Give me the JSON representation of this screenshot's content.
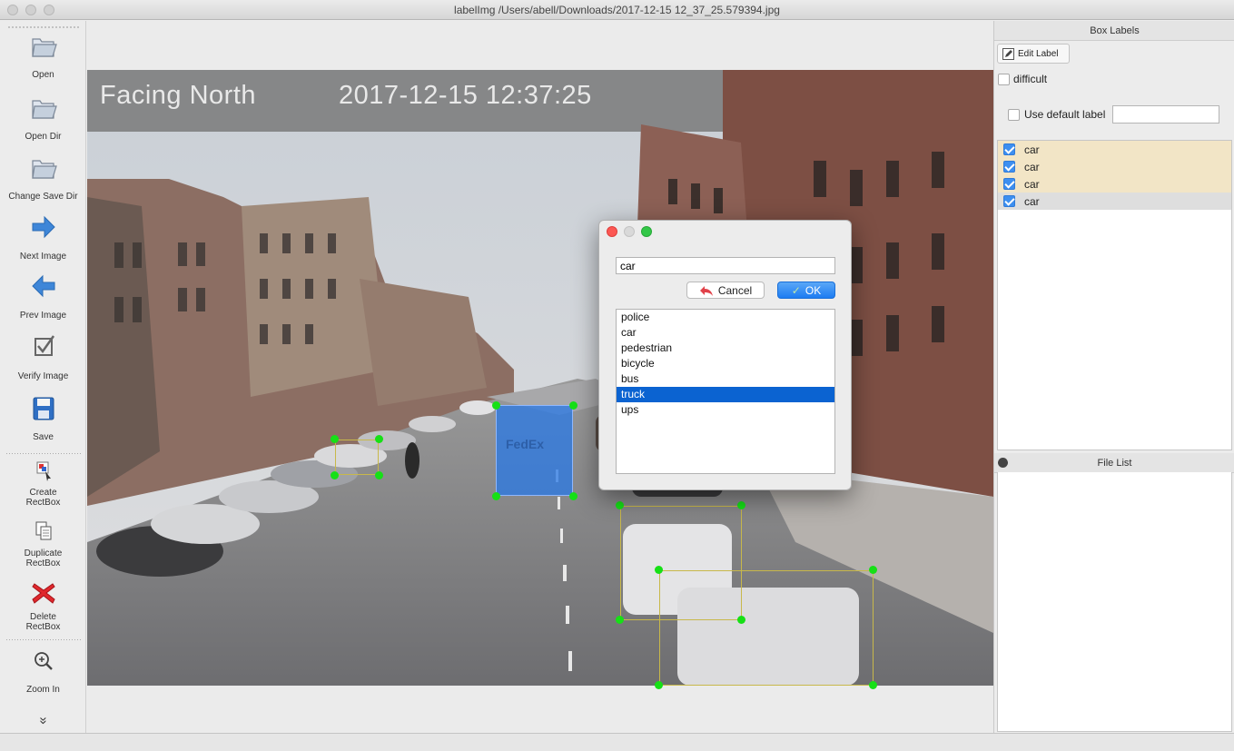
{
  "window": {
    "title": "labelImg /Users/abell/Downloads/2017-12-15 12_37_25.579394.jpg"
  },
  "toolbar": {
    "open": "Open",
    "open_dir": "Open Dir",
    "change_save_dir": "Change Save Dir",
    "next_image": "Next Image",
    "prev_image": "Prev Image",
    "verify_image": "Verify Image",
    "save": "Save",
    "create_rectbox_1": "Create",
    "create_rectbox_2": "RectBox",
    "duplicate_rectbox_1": "Duplicate",
    "duplicate_rectbox_2": "RectBox",
    "delete_rectbox_1": "Delete",
    "delete_rectbox_2": "RectBox",
    "zoom_in": "Zoom In",
    "more": "»"
  },
  "image": {
    "overlay_location": "Facing North",
    "overlay_timestamp": "2017-12-15 12:37:25",
    "truck_logo": "FedEx"
  },
  "dialog": {
    "input_value": "car",
    "cancel_label": "Cancel",
    "ok_label": "OK",
    "options": [
      "police",
      "car",
      "pedestrian",
      "bicycle",
      "bus",
      "truck",
      "ups"
    ],
    "selected_option": "truck"
  },
  "right_panel": {
    "box_labels_title": "Box Labels",
    "edit_label_button": "Edit Label",
    "difficult_label": "difficult",
    "use_default_label": "Use default label",
    "default_label_value": "",
    "labels": [
      {
        "text": "car",
        "checked": true
      },
      {
        "text": "car",
        "checked": true
      },
      {
        "text": "car",
        "checked": true
      },
      {
        "text": "car",
        "checked": true
      }
    ],
    "file_list_title": "File List"
  },
  "colors": {
    "accent": "#1d7cf2",
    "box_outline": "#c8b84a",
    "handle": "#16e016",
    "selected_fill": "#2878e6"
  }
}
